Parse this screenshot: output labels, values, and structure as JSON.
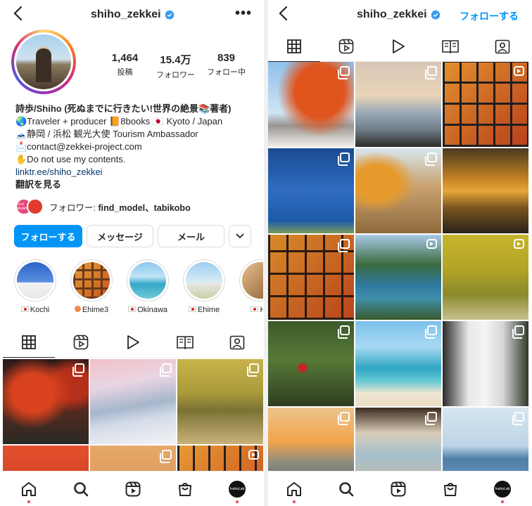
{
  "left": {
    "username": "shiho_zekkei",
    "more_label": "•••",
    "stats": [
      {
        "num": "1,464",
        "label": "投稿"
      },
      {
        "num": "15.4万",
        "label": "フォロワー"
      },
      {
        "num": "839",
        "label": "フォロー中"
      }
    ],
    "bio": {
      "name": "詩歩/Shiho (死ぬまでに行きたい!世界の絶景📚著者)",
      "line1": "🌏Traveler + producer 📙8books 🇯🇵 Kyoto / Japan",
      "line2": "🗻静岡 / 浜松 観光大使 Tourism Ambassador",
      "line3": "📩contact@zekkei-project.com",
      "line4": "✋Do not use my contents.",
      "link": "linktr.ee/shiho_zekkei",
      "translate": "翻訳を見る"
    },
    "followed_by": {
      "prefix": "フォロワー: ",
      "names": "find_model、tabikobo",
      "avatar1_text": "Find Model"
    },
    "buttons": {
      "follow": "フォローする",
      "message": "メッセージ",
      "mail": "メール",
      "more": "⌄"
    },
    "highlights": [
      "Kochi",
      "Ehime3",
      "Okinawa",
      "Ehime",
      "Ha"
    ],
    "highlight_prefix": [
      "flag-jp",
      "peach",
      "flag-jp",
      "flag-jp",
      "flag-jp"
    ]
  },
  "right": {
    "username": "shiho_zekkei",
    "follow_link": "フォローする"
  },
  "nav": {
    "profile_avatar_text": "InshoLab"
  },
  "colors": {
    "accent": "#0095f6",
    "text": "#262626",
    "border": "#dbdbdb",
    "notify": "#ed4956"
  }
}
